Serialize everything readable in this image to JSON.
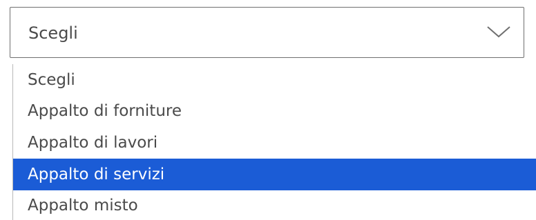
{
  "select": {
    "value": "Scegli",
    "icon": "chevron-down-icon",
    "options": [
      {
        "label": "Scegli"
      },
      {
        "label": "Appalto di forniture"
      },
      {
        "label": "Appalto di lavori"
      },
      {
        "label": "Appalto di servizi",
        "highlighted": true
      },
      {
        "label": "Appalto misto"
      }
    ],
    "colors": {
      "highlight": "#1b5cd6",
      "text": "#4a4a4a",
      "border": "#6f6f6f"
    }
  }
}
